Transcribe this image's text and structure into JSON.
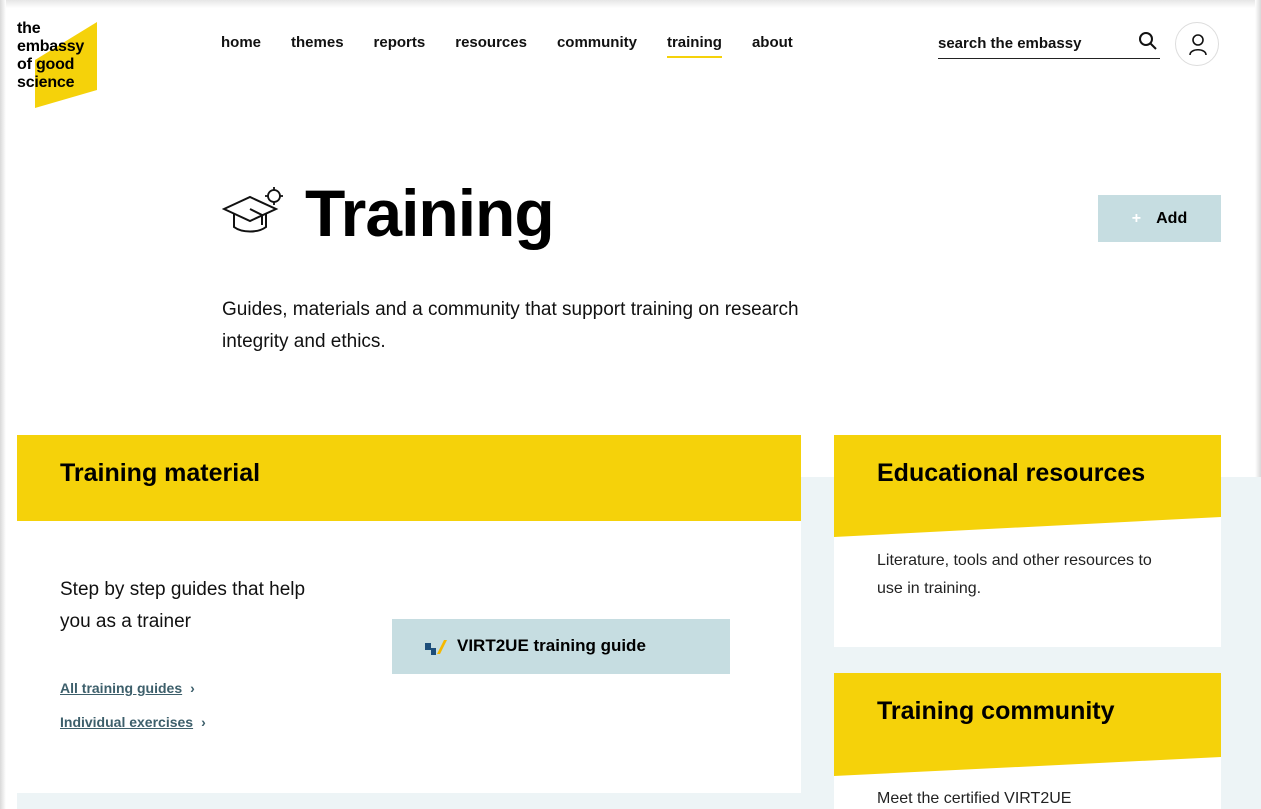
{
  "header": {
    "logo_lines": [
      "the",
      "embassy",
      "of good",
      "science"
    ],
    "nav": [
      "home",
      "themes",
      "reports",
      "resources",
      "community",
      "training",
      "about"
    ],
    "active_nav": "training",
    "search_placeholder": "search the embassy"
  },
  "hero": {
    "title": "Training",
    "add_button": "Add",
    "description": "Guides, materials and a community that support training on research integrity and ethics."
  },
  "training_material": {
    "title": "Training material",
    "description": "Step by step guides that help you as a trainer",
    "links": [
      "All training guides",
      "Individual exercises"
    ],
    "guide_button": "VIRT2UE training guide"
  },
  "educational_resources": {
    "title": "Educational resources",
    "description": "Literature, tools and other resources to use in training."
  },
  "training_community": {
    "title": "Training community",
    "description": "Meet the certified VIRT2UE"
  },
  "colors": {
    "accent_yellow": "#f5d20a",
    "button_blue": "#c6dde1",
    "band_bg": "#edf4f6",
    "link": "#3d5f6b"
  }
}
